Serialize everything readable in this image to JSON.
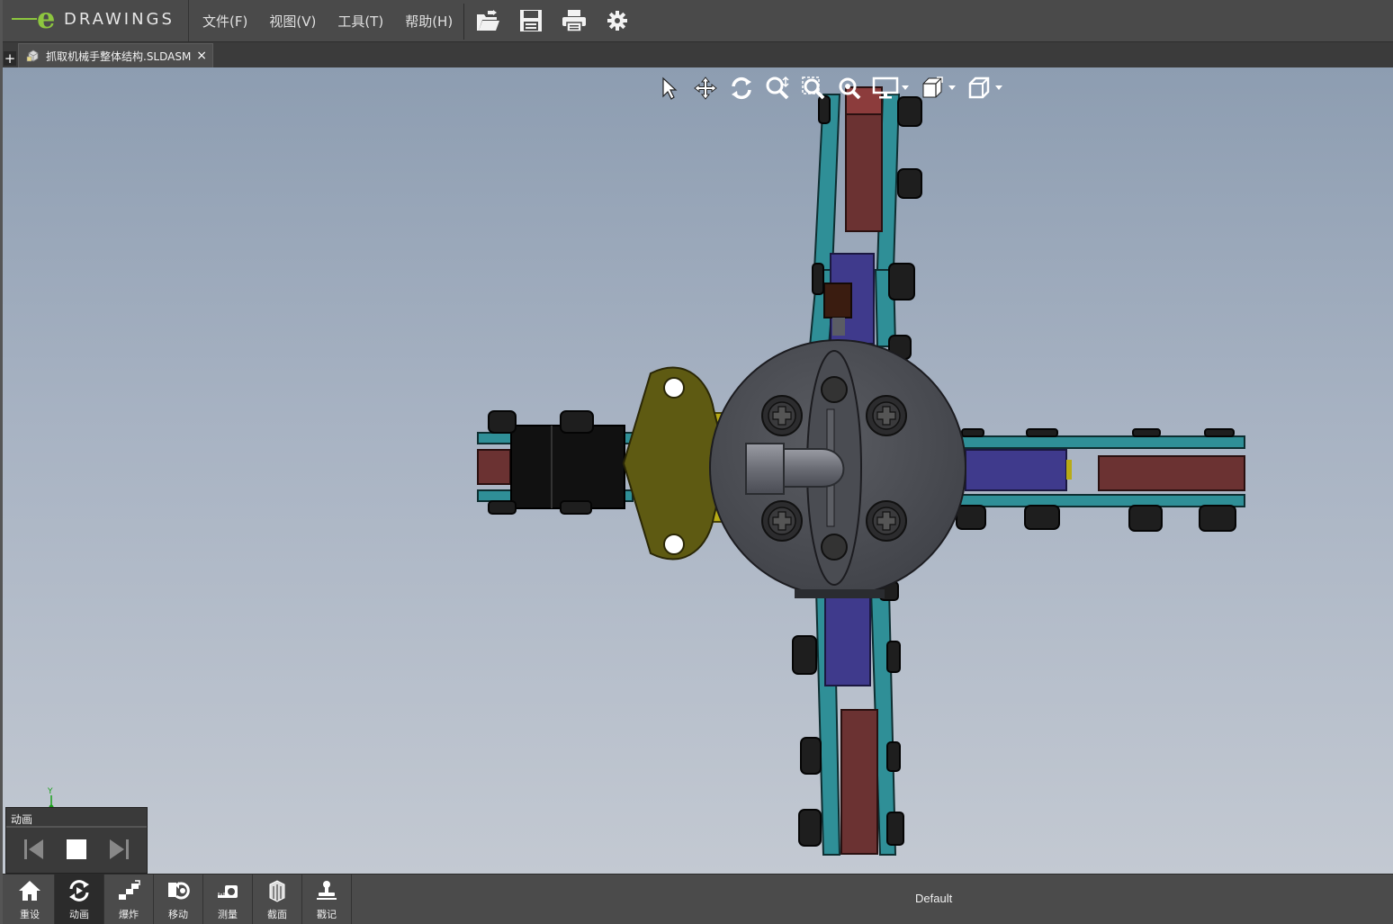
{
  "app": {
    "brand": "DRAWINGS"
  },
  "menu": {
    "items": [
      "文件(F)",
      "视图(V)",
      "工具(T)",
      "帮助(H)"
    ]
  },
  "toolbar": {
    "icons": [
      "open-icon",
      "save-icon",
      "print-icon",
      "settings-icon"
    ]
  },
  "tabs": {
    "add_label": "+",
    "document_title": "抓取机械手整体结构.SLDASM",
    "close_label": "×"
  },
  "view_toolbar": {
    "icons": [
      "select-icon",
      "pan-icon",
      "rotate-icon",
      "zoom-icon",
      "zoom-to-area-icon",
      "zoom-to-fit-icon",
      "display-style-icon",
      "view-orientation-icon",
      "standard-views-icon"
    ]
  },
  "triad": {
    "y_label": "Y"
  },
  "animation": {
    "title": "动画"
  },
  "bottom_tools": [
    {
      "label": "重设",
      "icon": "home-icon"
    },
    {
      "label": "动画",
      "icon": "animate-icon"
    },
    {
      "label": "爆炸",
      "icon": "explode-icon"
    },
    {
      "label": "移动",
      "icon": "move-icon"
    },
    {
      "label": "测量",
      "icon": "measure-icon"
    },
    {
      "label": "截面",
      "icon": "section-icon"
    },
    {
      "label": "戳记",
      "icon": "stamp-icon"
    }
  ],
  "status": {
    "configuration": "Default"
  },
  "colors": {
    "background_top": "#8d9db1",
    "background_bottom": "#c3c9d2",
    "link_teal": "#2f8f97",
    "pad_red": "#6b3232",
    "slider_blue": "#3f3a8c",
    "plate_olive": "#5e5a12",
    "hub_gray": "#4a4c52"
  }
}
